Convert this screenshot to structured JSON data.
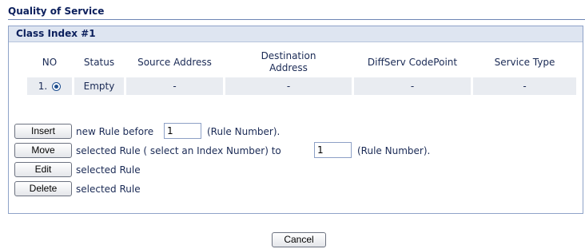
{
  "page": {
    "title": "Quality of Service"
  },
  "class_section": {
    "title": "Class Index #1"
  },
  "table": {
    "headers": {
      "no": "NO",
      "status": "Status",
      "source": "Source Address",
      "destination_line1": "Destination",
      "destination_line2": "Address",
      "diffserv": "DiffServ CodePoint",
      "service_type": "Service Type"
    },
    "rows": [
      {
        "no": "1.",
        "status": "Empty",
        "source": "-",
        "destination": "-",
        "diffserv": "-",
        "service_type": "-",
        "selected": true
      }
    ]
  },
  "actions": {
    "insert": {
      "button": "Insert",
      "text_before": "new Rule before",
      "input_value": "1",
      "text_after": "(Rule Number)."
    },
    "move": {
      "button": "Move",
      "text_before": "selected Rule ( select an Index Number) to",
      "input_value": "1",
      "text_after": "(Rule Number)."
    },
    "edit": {
      "button": "Edit",
      "text": "selected Rule"
    },
    "delete": {
      "button": "Delete",
      "text": "selected Rule"
    }
  },
  "footer": {
    "cancel_label": "Cancel"
  }
}
